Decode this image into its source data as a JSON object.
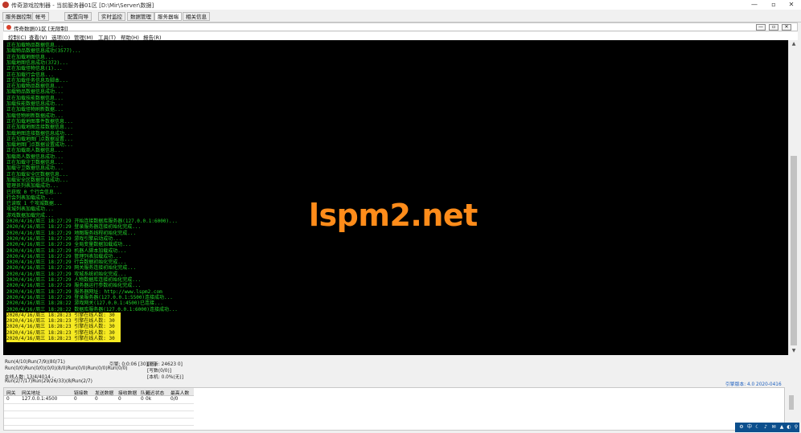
{
  "window": {
    "title": "传奇游戏控制器 - 当前服务器01区 [D:\\Mir\\Server\\数据]",
    "controls": [
      "—",
      "▫",
      "✕"
    ]
  },
  "tabs": [
    {
      "label": "服务器控制"
    },
    {
      "label": "帐号"
    },
    {
      "label": "配置向导"
    },
    {
      "label": "实时监控"
    },
    {
      "label": "数据管理"
    },
    {
      "label": "服务器端"
    },
    {
      "label": "相关信息"
    }
  ],
  "inner_window": {
    "title": "传奇数据01区 [无限制]",
    "controls": [
      "—",
      "▫",
      "✕"
    ]
  },
  "menu": [
    "控制(C)",
    "查看(V)",
    "选项(O)",
    "管理(M)",
    "工具(T)",
    "帮助(H)",
    "报告(R)"
  ],
  "console": {
    "lines": [
      "正在加载物品数据信息...",
      "加载物品数据信息成功(3577)...",
      "正在加载地图信息...",
      "加载地图信息成功(372)...",
      "正在加载怪物信息(1)...",
      "正在加载行会信息...",
      "正在加载任务信息及脚本...",
      "正在加载物品数据信息...",
      "加载物品数据信息成功...",
      "正在加载技能数据信息...",
      "加载技能数据信息成功...",
      "正在加载怪物刷新数据...",
      "加载怪物刷新数据成功...",
      "正在加载地图事件数据信息...",
      "正在加载地图连接数据信息...",
      "加载地图连接数据信息成功...",
      "正在加载地图门点数据设置...",
      "加载地图门点数据设置成功...",
      "正在加载商人数据信息...",
      "加载商人数据信息成功...",
      "正在加载守卫数据信息...",
      "加载守卫数据信息成功...",
      "正在加载安全区数据信息...",
      "加载安全区数据信息成功...",
      "管理员列表加载成功...",
      "已获取 0 个行会信息...",
      "行会列表加载成功...",
      "已读取 1 个攻城数据...",
      "攻城列表加载成功...",
      "游戏数据加载完成...",
      "2020/4/16/周三 18:27:29 开始连接数据库服务器(127.0.0.1:6000)...",
      "2020/4/16/周三 18:27:29 登录服务器连接初始化完成...",
      "2020/4/16/周三 18:27:29 地图服务线程初始化完成...",
      "2020/4/16/周三 18:27:29 游戏引擎启动成功...",
      "2020/4/16/周三 18:27:29 全局变量数据加载成功...",
      "2020/4/16/周三 18:27:29 机器人脚本加载成功...",
      "2020/4/16/周三 18:27:29 管理列表加载成功...",
      "2020/4/16/周三 18:27:29 行会数据初始化完成...",
      "2020/4/16/周三 18:27:29 网关服务连接初始化完成...",
      "2020/4/16/周三 18:27:29 攻城系统初始化完成...",
      "2020/4/16/周三 18:27:29 人物数据库连接初始化完成...",
      "2020/4/16/周三 18:27:29 服务器运行参数初始化完成...",
      "2020/4/16/周三 18:27:29 服务器网址: http://www.lspm2.com",
      "2020/4/16/周三 18:27:29 登录服务器(127.0.0.1:5500)连接成功...",
      "2020/4/16/周三 18:28:22 游戏网关(127.0.0.1:4500)已连接...",
      "2020/4/16/周三 18:28:22 数据库服务器(127.0.0.1:6000)连接成功..."
    ],
    "highlighted": [
      "2020/4/16/周三 18:28:23 引擎在线人数: 30",
      "2020/4/16/周三 18:28:23 引擎在线人数: 30",
      "2020/4/16/周三 18:28:23 引擎在线人数: 30",
      "2020/4/16/周三 18:28:23 引擎在线人数: 30",
      "2020/4/16/周三 18:28:23 引擎在线人数: 30"
    ],
    "watermark": "lspm2.net"
  },
  "status": {
    "line1": "Run(4/10)Run(7/9)(80/71)",
    "line2": "Run(0/0)Run(0/0)(0/0)(8/0)Run(0/0)Run(0/0)Run(0/0)",
    "line3": "在线人数: 13/4/4014 -",
    "line4": "Run(2/7/17)Run(29/26/33)(8/Run(2/7)",
    "col2": "引擎: 0:0:06 [30][正]",
    "col3a": "[刷新: 24623 0]",
    "col3b": "[写数(0/0)]",
    "col3c": "[本机: 0.0%(无)]",
    "version": "引擎版本: 4.0 2020-0416"
  },
  "grid": {
    "headers": [
      "网关",
      "网关地址",
      "链接数",
      "发送数据",
      "接收数据",
      "队列",
      "延迟状态",
      "最高人数"
    ],
    "rows": [
      [
        "0",
        "127.0.0.1:4500",
        "0",
        "0",
        "0",
        "0",
        "0k",
        "0/0"
      ]
    ]
  },
  "tray_icons": [
    "⚙",
    "中",
    "☾",
    "♪",
    "✉",
    "▲",
    "◐",
    "⚲"
  ]
}
